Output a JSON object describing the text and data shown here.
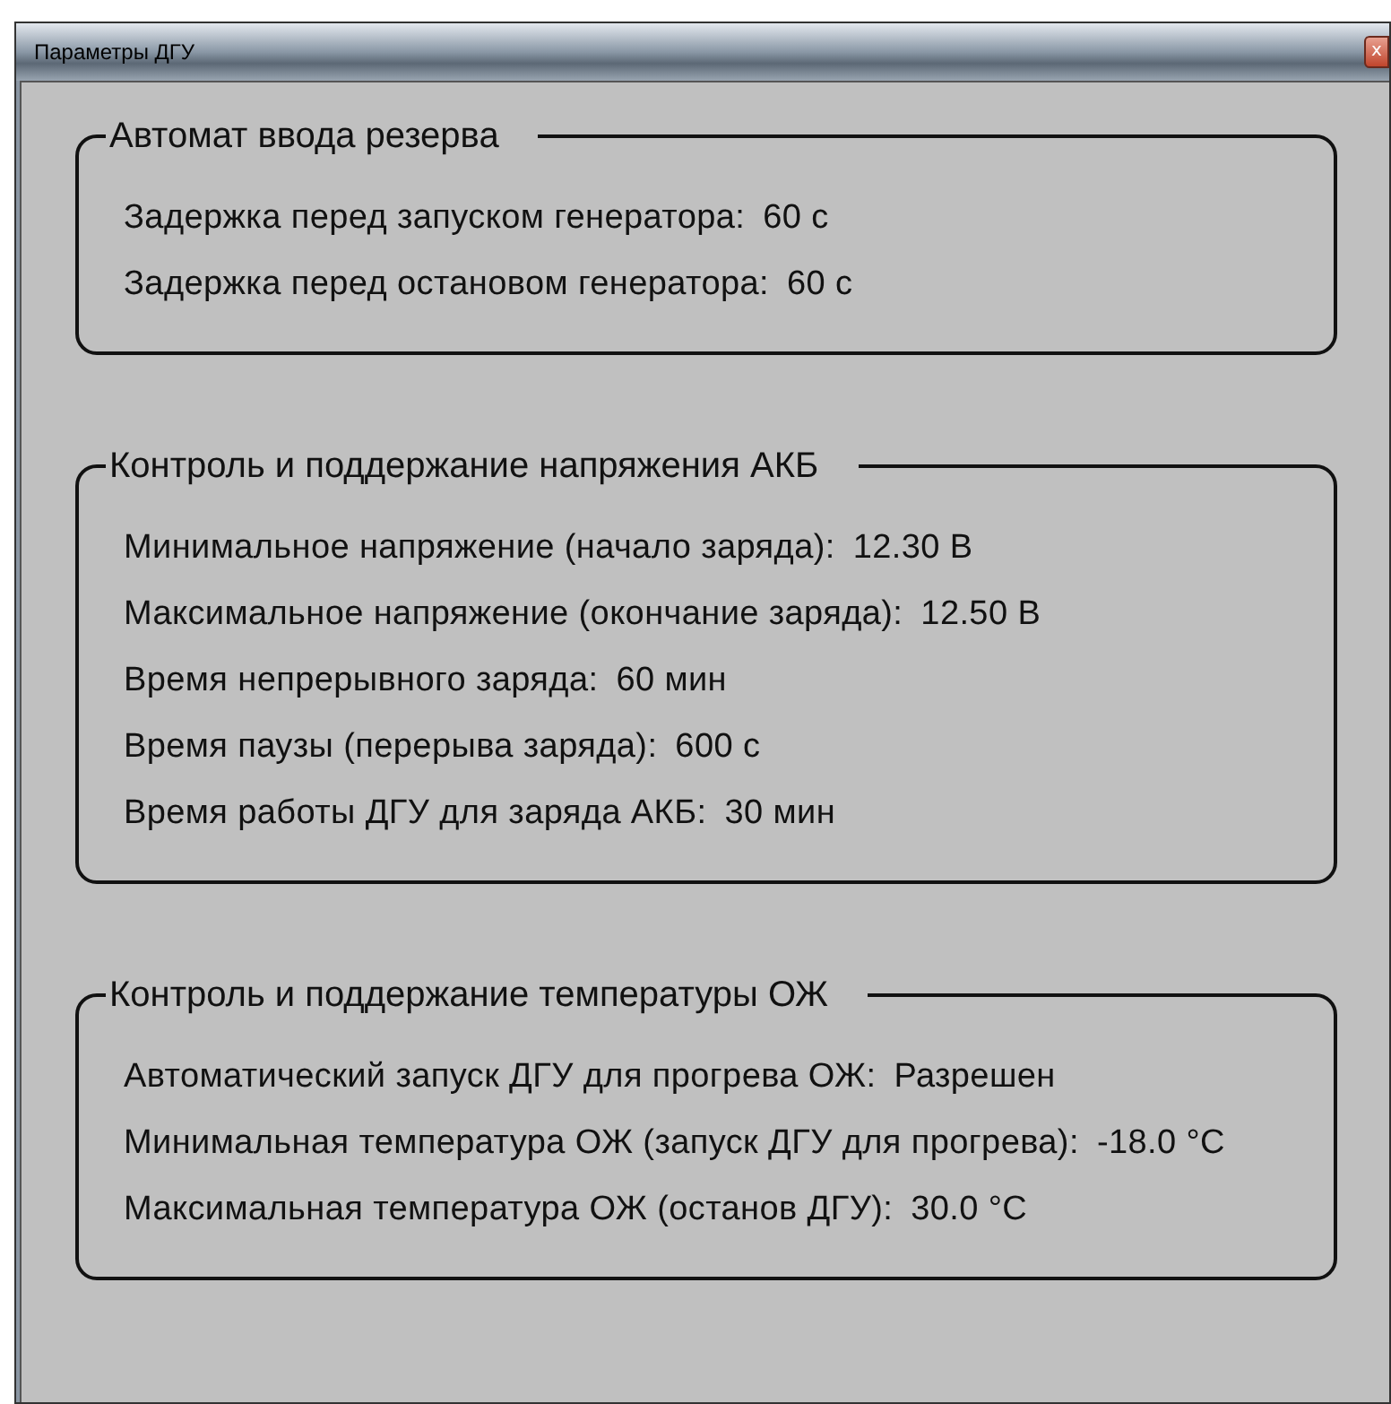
{
  "window": {
    "title": "Параметры ДГУ",
    "close": "x"
  },
  "groups": [
    {
      "title": "Автомат ввода резерва",
      "rows": [
        {
          "label": "Задержка перед запуском генератора:",
          "value": "60 с"
        },
        {
          "label": "Задержка перед остановом генератора:",
          "value": "60 с"
        }
      ]
    },
    {
      "title": "Контроль и поддержание напряжения АКБ",
      "rows": [
        {
          "label": "Минимальное напряжение (начало заряда):",
          "value": "12.30 В"
        },
        {
          "label": "Максимальное напряжение (окончание заряда):",
          "value": "12.50 В"
        },
        {
          "label": "Время непрерывного заряда:",
          "value": "60 мин"
        },
        {
          "label": "Время паузы (перерыва заряда):",
          "value": "600 с"
        },
        {
          "label": "Время работы ДГУ для заряда АКБ:",
          "value": "30 мин"
        }
      ]
    },
    {
      "title": "Контроль и поддержание температуры ОЖ",
      "rows": [
        {
          "label": "Автоматический запуск ДГУ для прогрева ОЖ:",
          "value": "Разрешен"
        },
        {
          "label": "Минимальная температура ОЖ (запуск ДГУ для прогрева):",
          "value": "-18.0 °C"
        },
        {
          "label": "Максимальная температура ОЖ (останов ДГУ):",
          "value": "30.0 °C"
        }
      ]
    }
  ]
}
